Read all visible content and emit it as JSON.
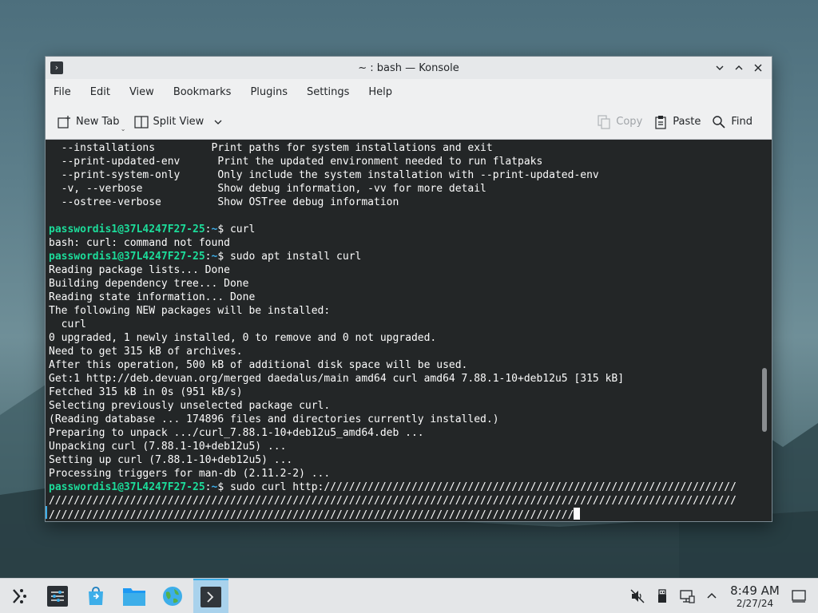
{
  "window": {
    "title": "~ : bash — Konsole",
    "app_icon": "terminal-icon"
  },
  "menubar": {
    "items": [
      "File",
      "Edit",
      "View",
      "Bookmarks",
      "Plugins",
      "Settings",
      "Help"
    ]
  },
  "toolbar": {
    "new_tab": "New Tab",
    "split_view": "Split View",
    "copy": "Copy",
    "paste": "Paste",
    "find": "Find"
  },
  "terminal": {
    "prompt_user": "passwordis1@37L4247F27-25",
    "prompt_path": "~",
    "lines": [
      {
        "type": "text",
        "text": "  --installations         Print paths for system installations and exit"
      },
      {
        "type": "text",
        "text": "  --print-updated-env      Print the updated environment needed to run flatpaks"
      },
      {
        "type": "text",
        "text": "  --print-system-only      Only include the system installation with --print-updated-env"
      },
      {
        "type": "text",
        "text": "  -v, --verbose            Show debug information, -vv for more detail"
      },
      {
        "type": "text",
        "text": "  --ostree-verbose         Show OSTree debug information"
      },
      {
        "type": "text",
        "text": ""
      },
      {
        "type": "prompt",
        "cmd": " curl"
      },
      {
        "type": "text",
        "text": "bash: curl: command not found"
      },
      {
        "type": "prompt",
        "cmd": " sudo apt install curl"
      },
      {
        "type": "text",
        "text": "Reading package lists... Done"
      },
      {
        "type": "text",
        "text": "Building dependency tree... Done"
      },
      {
        "type": "text",
        "text": "Reading state information... Done"
      },
      {
        "type": "text",
        "text": "The following NEW packages will be installed:"
      },
      {
        "type": "text",
        "text": "  curl"
      },
      {
        "type": "text",
        "text": "0 upgraded, 1 newly installed, 0 to remove and 0 not upgraded."
      },
      {
        "type": "text",
        "text": "Need to get 315 kB of archives."
      },
      {
        "type": "text",
        "text": "After this operation, 500 kB of additional disk space will be used."
      },
      {
        "type": "text",
        "text": "Get:1 http://deb.devuan.org/merged daedalus/main amd64 curl amd64 7.88.1-10+deb12u5 [315 kB]"
      },
      {
        "type": "text",
        "text": "Fetched 315 kB in 0s (951 kB/s)"
      },
      {
        "type": "text",
        "text": "Selecting previously unselected package curl."
      },
      {
        "type": "text",
        "text": "(Reading database ... 174896 files and directories currently installed.)"
      },
      {
        "type": "text",
        "text": "Preparing to unpack .../curl_7.88.1-10+deb12u5_amd64.deb ..."
      },
      {
        "type": "text",
        "text": "Unpacking curl (7.88.1-10+deb12u5) ..."
      },
      {
        "type": "text",
        "text": "Setting up curl (7.88.1-10+deb12u5) ..."
      },
      {
        "type": "text",
        "text": "Processing triggers for man-db (2.11.2-2) ..."
      },
      {
        "type": "prompt",
        "cmd": " sudo curl http://////////////////////////////////////////////////////////////////"
      },
      {
        "type": "text",
        "text": "//////////////////////////////////////////////////////////////////////////////////////////////////////////////"
      },
      {
        "type": "input",
        "text": "////////////////////////////////////////////////////////////////////////////////////"
      }
    ]
  },
  "taskbar": {
    "items": [
      {
        "name": "app-launcher-icon",
        "active": false
      },
      {
        "name": "system-settings-icon",
        "active": false
      },
      {
        "name": "discover-store-icon",
        "active": false
      },
      {
        "name": "file-manager-icon",
        "active": false
      },
      {
        "name": "web-browser-icon",
        "active": false
      },
      {
        "name": "konsole-icon",
        "active": true
      }
    ],
    "tray": [
      "volume-muted-icon",
      "usb-device-icon",
      "network-icon",
      "tray-expand-icon"
    ],
    "clock": {
      "time": "8:49 AM",
      "date": "2/27/24"
    }
  },
  "colors": {
    "prompt_user": "#1cdc9a",
    "prompt_path": "#3daee9",
    "terminal_bg": "#232627",
    "accent": "#3daee9"
  }
}
